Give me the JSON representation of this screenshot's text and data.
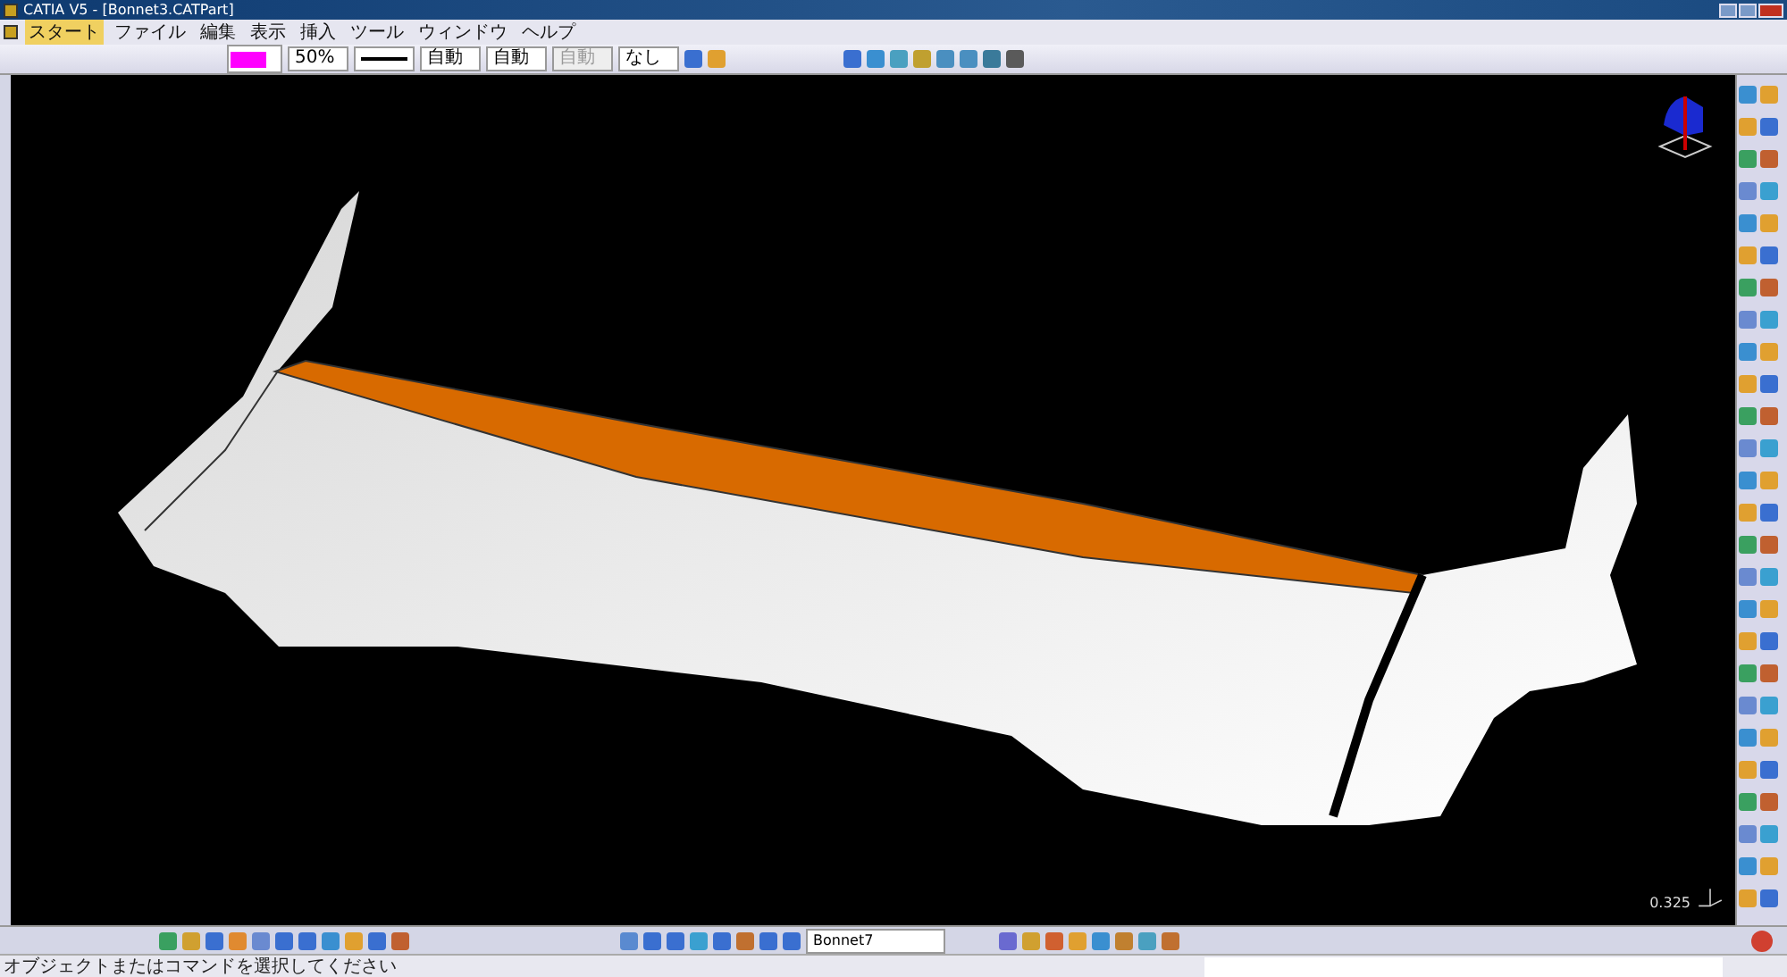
{
  "window": {
    "title": "CATIA V5 - [Bonnet3.CATPart]"
  },
  "menu": [
    {
      "label": "スタート",
      "selected": true
    },
    {
      "label": "ファイル",
      "selected": false
    },
    {
      "label": "編集",
      "selected": false
    },
    {
      "label": "表示",
      "selected": false
    },
    {
      "label": "挿入",
      "selected": false
    },
    {
      "label": "ツール",
      "selected": false
    },
    {
      "label": "ウィンドウ",
      "selected": false
    },
    {
      "label": "ヘルプ",
      "selected": false
    }
  ],
  "toolbar": {
    "color": "#ff00ff",
    "transparency": "50%",
    "line_weight": {
      "value": "自動",
      "disabled": false
    },
    "line_type": {
      "value": "自動",
      "disabled": false
    },
    "point_type": {
      "value": "自動",
      "disabled": true
    },
    "layer": "なし"
  },
  "viewport": {
    "scale": "0.325"
  },
  "bottom_toolbar": {
    "current_body": "Bonnet7"
  },
  "status_bar": {
    "message": "オブジェクトまたはコマンドを選択してください"
  }
}
